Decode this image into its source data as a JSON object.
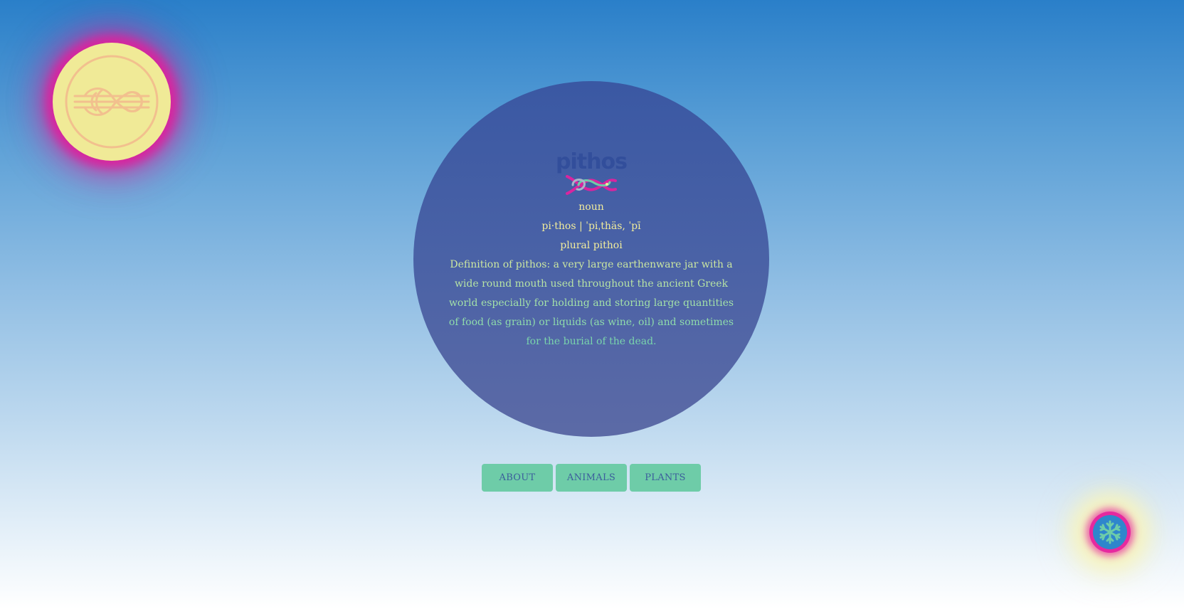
{
  "logo": {
    "icon": "reef-knot-icon",
    "colors": {
      "badge": "#f0ea97",
      "glow": "#d8259f",
      "knot": "#f2c08e"
    }
  },
  "wordmark": {
    "text": "pithos",
    "icon": "knot-icon",
    "colors": {
      "text": "#324e9b",
      "knot_a": "#d8259f",
      "knot_b": "#6ecca8",
      "knot_c": "#a9b6c9"
    }
  },
  "entry": {
    "part_of_speech": "noun",
    "pronunciation": "pi·thos | ˈpiˌthäs, ˈpī",
    "plural": "plural pithoi",
    "definition": "Definition of pithos: a very large earthenware jar with a wide round mouth used throughout the ancient Greek world especially for holding and storing large quantities of food (as grain) or liquids (as wine, oil) and sometimes for the burial of the dead."
  },
  "nav": {
    "items": [
      {
        "label": "ABOUT"
      },
      {
        "label": "ANIMALS"
      },
      {
        "label": "PLANTS"
      }
    ],
    "colors": {
      "button": "#6ecca8",
      "text": "#3c5d9c"
    }
  },
  "corner_badge": {
    "icon": "snowflake-icon",
    "colors": {
      "center": "#2f86cc",
      "ring": "#e6299f",
      "glow": "#f6f3bc",
      "flake": "#6ecca8"
    }
  },
  "theme": {
    "circle": "#4a62a6",
    "text_primary": "#f1ec9c",
    "text_definition": "#9be3aa"
  }
}
